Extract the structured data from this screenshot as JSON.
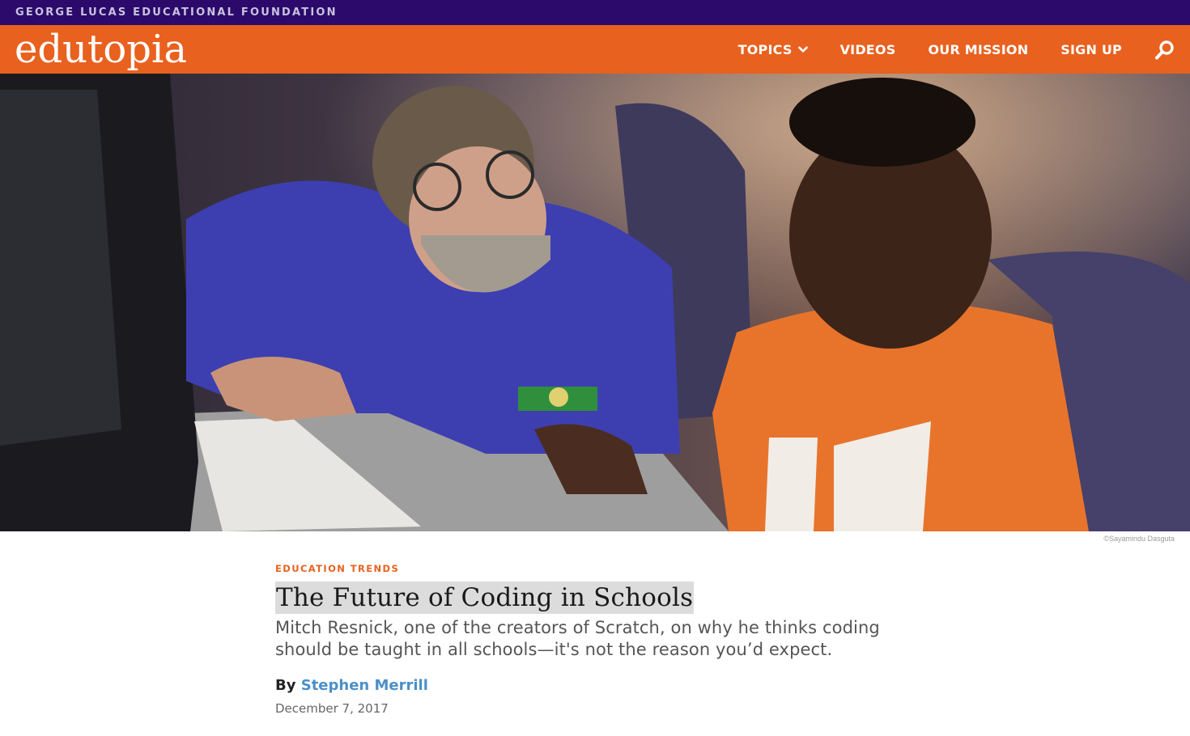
{
  "topbar": {
    "foundation_label": "GEORGE LUCAS EDUCATIONAL FOUNDATION"
  },
  "header": {
    "logo_text": "edutopia",
    "nav": [
      "TOPICS",
      "VIDEOS",
      "OUR MISSION",
      "SIGN UP"
    ],
    "icons": {
      "topics_dropdown": "chevron-down-icon",
      "search": "search-icon"
    }
  },
  "hero": {
    "credit": "©Sayamindu Dasguta"
  },
  "article": {
    "category": "EDUCATION TRENDS",
    "title": "The Future of Coding in Schools",
    "dek_line1": "Mitch Resnick, one of the creators of Scratch, on why he thinks coding",
    "dek_line2": "should be taught in all schools—it's not the reason you’d expect.",
    "by_label": "By",
    "author": "Stephen Merrill",
    "date": "December 7, 2017"
  },
  "colors": {
    "topbar": "#2b0a6b",
    "nav": "#e8611f",
    "category": "#e8611f",
    "author_link": "#4a90c8"
  }
}
